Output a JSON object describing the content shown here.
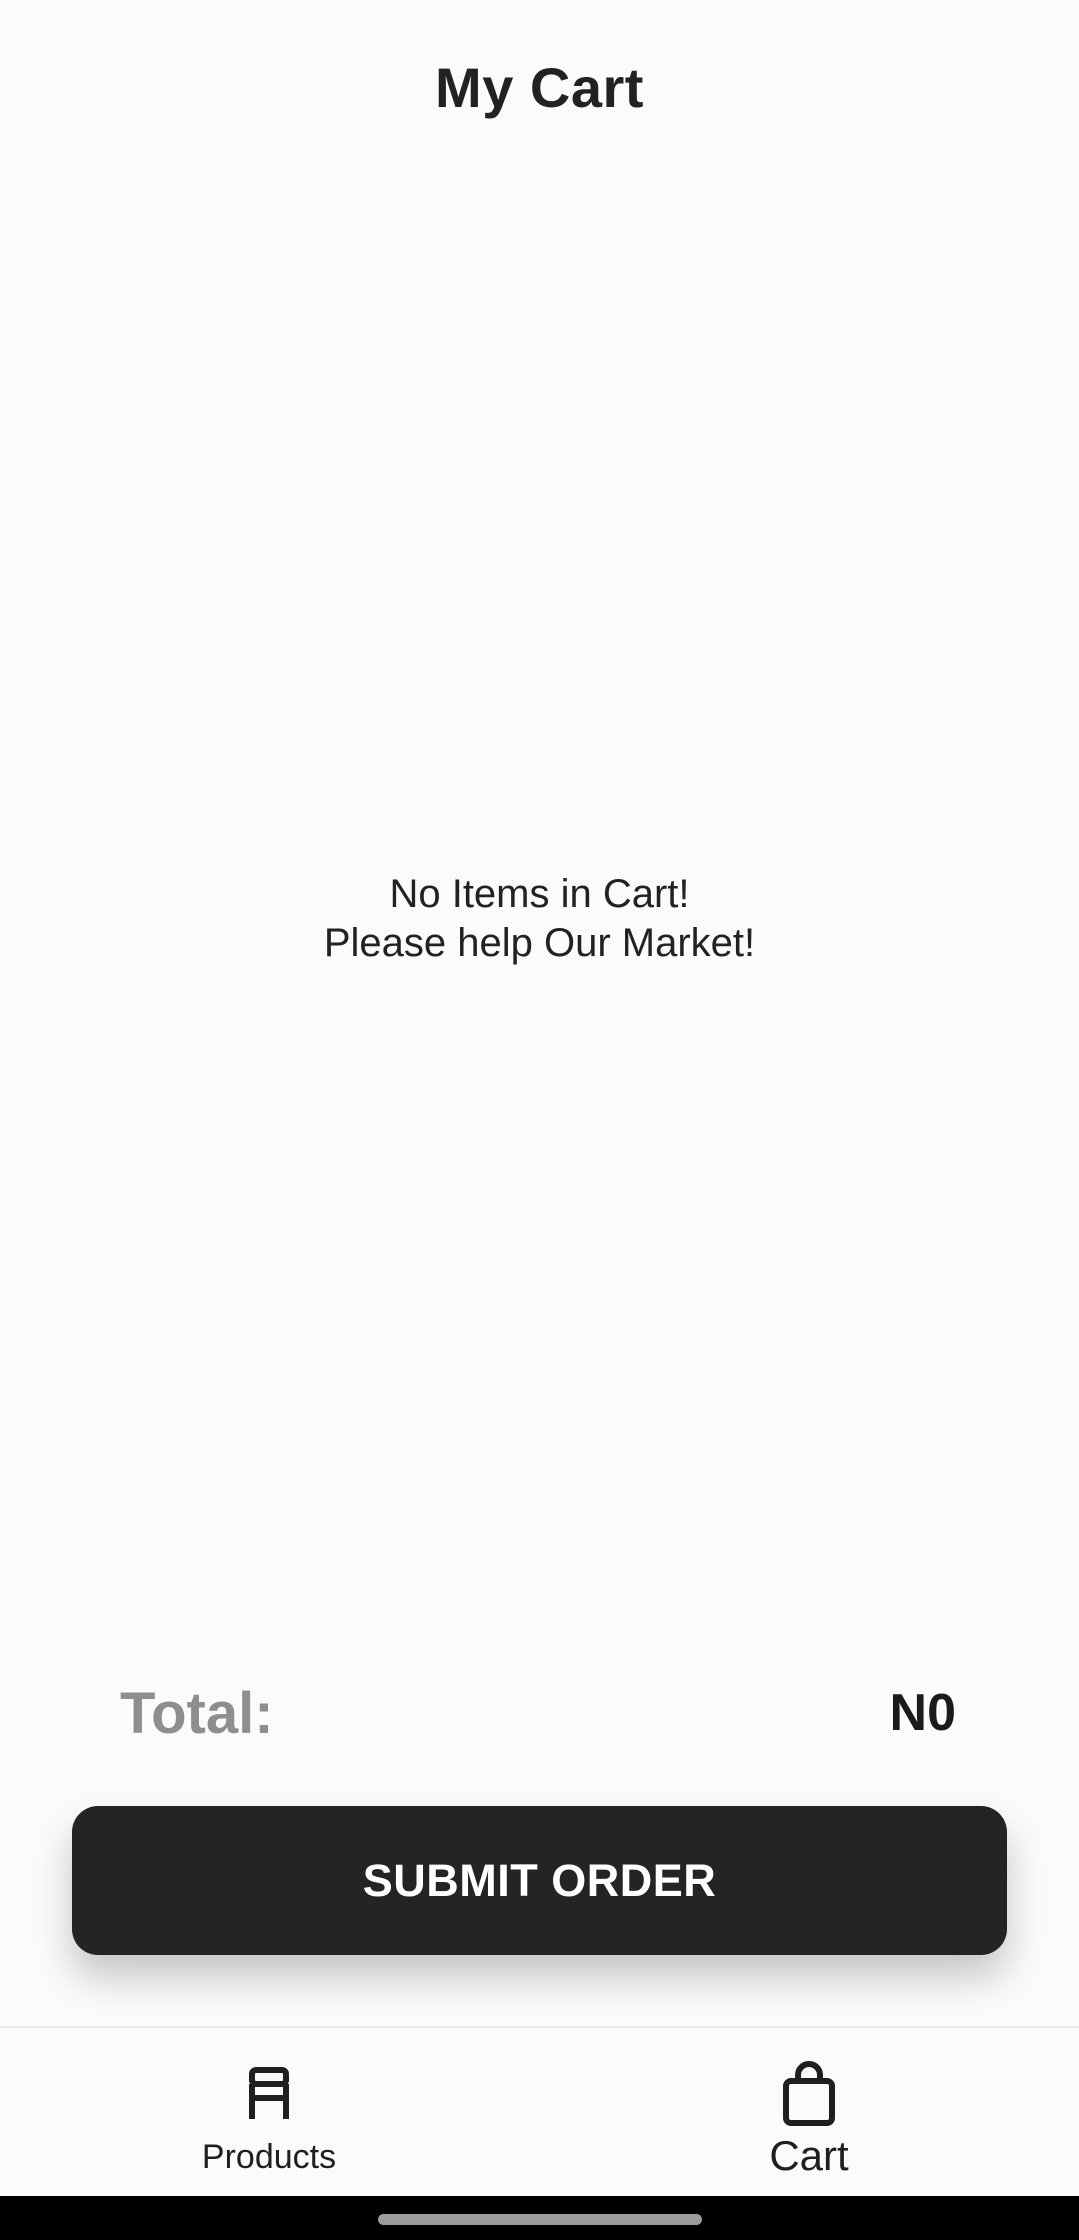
{
  "header": {
    "title": "My Cart"
  },
  "empty_state": {
    "line1": "No Items in Cart!",
    "line2": "Please help Our Market!"
  },
  "summary": {
    "total_label": "Total:",
    "total_value": "N0"
  },
  "actions": {
    "submit_label": "SUBMIT ORDER"
  },
  "bottom_nav": {
    "items": [
      {
        "label": "Products",
        "icon": "store-icon"
      },
      {
        "label": "Cart",
        "icon": "shopping-bag-icon",
        "selected": true
      }
    ]
  },
  "colors": {
    "background": "#fcfbfb",
    "button": "#242424",
    "total_label": "#8e8e8e"
  }
}
